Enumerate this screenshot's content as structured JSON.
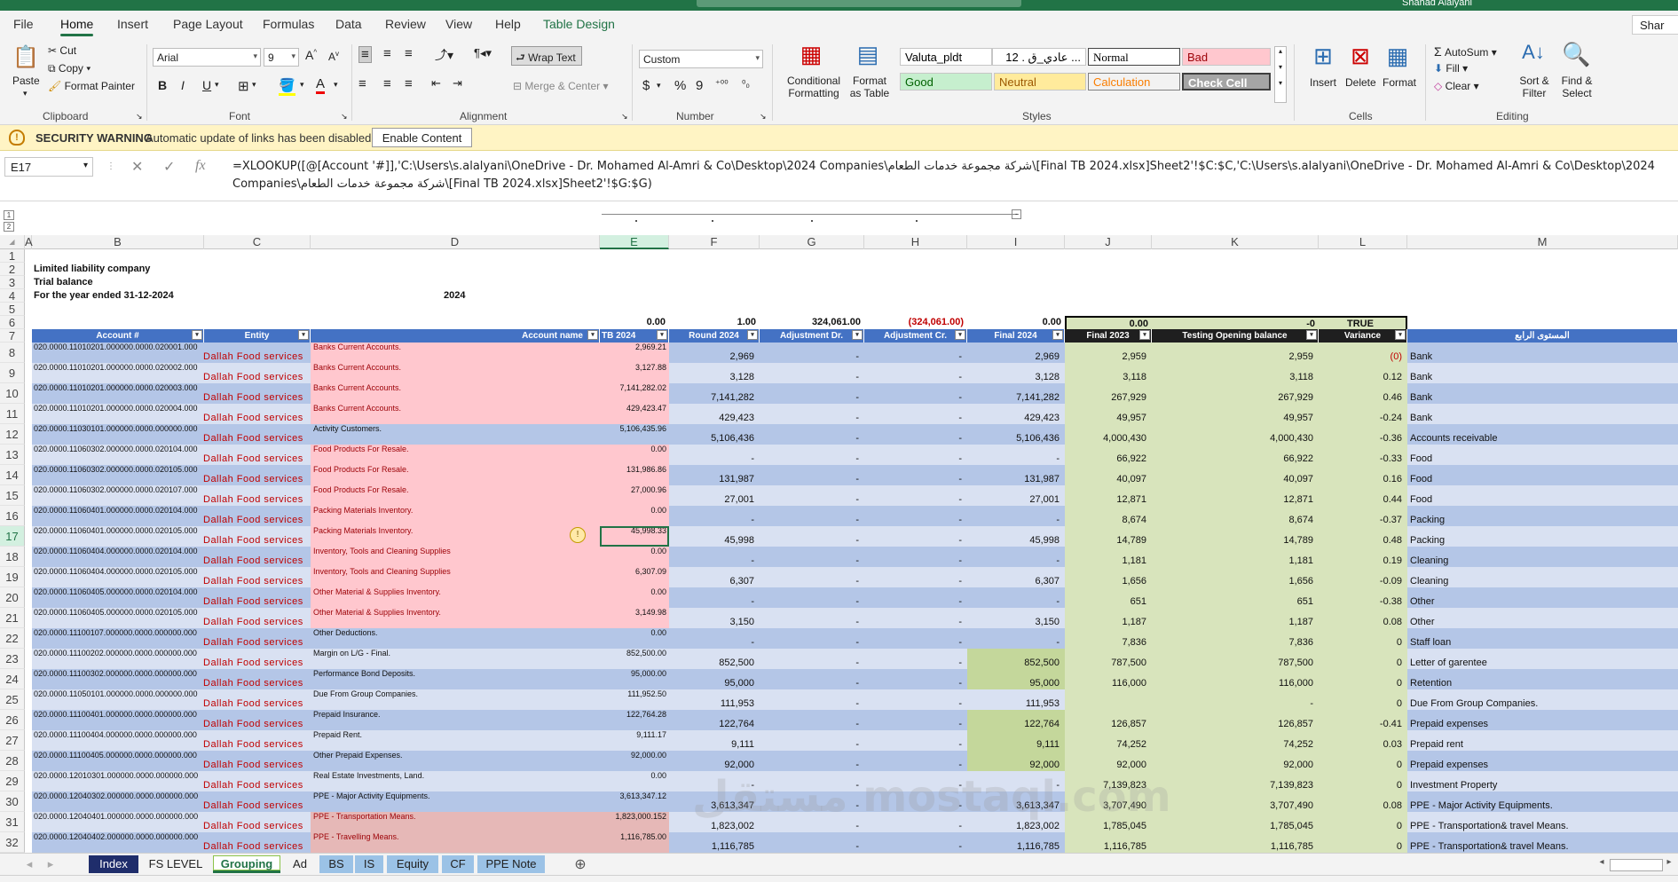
{
  "app": {
    "user": "Shahad Alalyani"
  },
  "menu": {
    "items": [
      "File",
      "Home",
      "Insert",
      "Page Layout",
      "Formulas",
      "Data",
      "Review",
      "View",
      "Help",
      "Table Design"
    ],
    "share": "Shar"
  },
  "ribbon": {
    "clipboard": {
      "paste": "Paste",
      "cut": "Cut",
      "copy": "Copy",
      "format_painter": "Format Painter",
      "label": "Clipboard"
    },
    "font": {
      "name": "Arial",
      "size": "9",
      "label": "Font",
      "bold": "B",
      "italic": "I",
      "underline": "U"
    },
    "alignment": {
      "wrap": "Wrap Text",
      "merge": "Merge & Center",
      "label": "Alignment"
    },
    "number": {
      "format": "Custom",
      "label": "Number",
      "currency": "$",
      "percent": "%",
      "comma": "9"
    },
    "styles": {
      "cond": "Conditional Formatting",
      "format_table": "Format as Table",
      "label": "Styles",
      "cells": [
        {
          "text": "Valuta_pldt",
          "bg": "#ffffff",
          "fg": "#000000"
        },
        {
          "text": "عادي_ق . 12 ...",
          "bg": "#ffffff",
          "fg": "#000000"
        },
        {
          "text": "Normal",
          "bg": "#ffffff",
          "fg": "#000000"
        },
        {
          "text": "Bad",
          "bg": "#ffc7ce",
          "fg": "#9c0006"
        },
        {
          "text": "Good",
          "bg": "#c6efce",
          "fg": "#006100"
        },
        {
          "text": "Neutral",
          "bg": "#ffeb9c",
          "fg": "#9c5700"
        },
        {
          "text": "Calculation",
          "bg": "#f2f2f2",
          "fg": "#fa7d00"
        },
        {
          "text": "Check Cell",
          "bg": "#a5a5a5",
          "fg": "#ffffff"
        }
      ]
    },
    "cells": {
      "insert": "Insert",
      "delete": "Delete",
      "format": "Format",
      "label": "Cells"
    },
    "editing": {
      "autosum": "AutoSum",
      "fill": "Fill",
      "clear": "Clear",
      "sort": "Sort & Filter",
      "find": "Find & Select",
      "label": "Editing"
    }
  },
  "security": {
    "title": "SECURITY WARNING",
    "message": "Automatic update of links has been disabled",
    "button": "Enable Content"
  },
  "formula_bar": {
    "name_box": "E17",
    "formula": "=XLOOKUP([@[Account '#]],'C:\\Users\\s.alalyani\\OneDrive - Dr. Mohamed Al-Amri & Co\\Desktop\\2024 Companies\\شركة مجموعة خدمات الطعام\\[Final TB 2024.xlsx]Sheet2'!$C:$C,'C:\\Users\\s.alalyani\\OneDrive - Dr. Mohamed Al-Amri & Co\\Desktop\\2024 Companies\\شركة مجموعة خدمات الطعام\\[Final TB 2024.xlsx]Sheet2'!$G:$G)"
  },
  "columns": [
    "A",
    "B",
    "C",
    "D",
    "E",
    "F",
    "G",
    "H",
    "I",
    "J",
    "K",
    "L",
    "M"
  ],
  "sheet": {
    "company": "Limited liability company",
    "title": "Trial balance",
    "period": "For the year ended 31-12-2024",
    "year": "2024",
    "row6": {
      "E": "0.00",
      "F": "1.00",
      "G": "324,061.00",
      "H": "(324,061.00)",
      "I": "0.00",
      "J": "0.00",
      "K": "-0",
      "L": "TRUE"
    },
    "headers": [
      "Account #",
      "Entity",
      "Account name",
      "TB 2024",
      "Round 2024",
      "Adjustment Dr.",
      "Adjustment Cr.",
      "Final 2024",
      "Final 2023",
      "Testing Opening balance",
      "Variance",
      "المستوى الرابع"
    ],
    "rows": [
      {
        "n": "8",
        "acc": "020.0000.11010201.000000.0000.020001.000",
        "ent": "Dallah Food  services",
        "name": "Banks Current Accounts.",
        "tb": "2,969.21",
        "rnd": "2,969",
        "dr": "-",
        "cr": "-",
        "f24": "2,969",
        "f23": "2,959",
        "test": "2,959",
        "var": "(0)",
        "lvl": "Bank"
      },
      {
        "n": "9",
        "acc": "020.0000.11010201.000000.0000.020002.000",
        "ent": "Dallah Food  services",
        "name": "Banks Current Accounts.",
        "tb": "3,127.88",
        "rnd": "3,128",
        "dr": "-",
        "cr": "-",
        "f24": "3,128",
        "f23": "3,118",
        "test": "3,118",
        "var": "0.12",
        "lvl": "Bank"
      },
      {
        "n": "10",
        "acc": "020.0000.11010201.000000.0000.020003.000",
        "ent": "Dallah Food  services",
        "name": "Banks Current Accounts.",
        "tb": "7,141,282.02",
        "rnd": "7,141,282",
        "dr": "-",
        "cr": "-",
        "f24": "7,141,282",
        "f23": "267,929",
        "test": "267,929",
        "var": "0.46",
        "lvl": "Bank"
      },
      {
        "n": "11",
        "acc": "020.0000.11010201.000000.0000.020004.000",
        "ent": "Dallah Food  services",
        "name": "Banks Current Accounts.",
        "tb": "429,423.47",
        "rnd": "429,423",
        "dr": "-",
        "cr": "-",
        "f24": "429,423",
        "f23": "49,957",
        "test": "49,957",
        "var": "-0.24",
        "lvl": "Bank"
      },
      {
        "n": "12",
        "acc": "020.0000.11030101.000000.0000.000000.000",
        "ent": "Dallah Food  services",
        "name": "Activity Customers.",
        "tb": "5,106,435.96",
        "rnd": "5,106,436",
        "dr": "-",
        "cr": "-",
        "f24": "5,106,436",
        "f23": "4,000,430",
        "test": "4,000,430",
        "var": "-0.36",
        "lvl": "Accounts receivable"
      },
      {
        "n": "13",
        "acc": "020.0000.11060302.000000.0000.020104.000",
        "ent": "Dallah Food  services",
        "name": "Food Products For Resale.",
        "tb": "0.00",
        "rnd": "-",
        "dr": "-",
        "cr": "-",
        "f24": "-",
        "f23": "66,922",
        "test": "66,922",
        "var": "-0.33",
        "lvl": "Food"
      },
      {
        "n": "14",
        "acc": "020.0000.11060302.000000.0000.020105.000",
        "ent": "Dallah Food  services",
        "name": "Food Products For Resale.",
        "tb": "131,986.86",
        "rnd": "131,987",
        "dr": "-",
        "cr": "-",
        "f24": "131,987",
        "f23": "40,097",
        "test": "40,097",
        "var": "0.16",
        "lvl": "Food"
      },
      {
        "n": "15",
        "acc": "020.0000.11060302.000000.0000.020107.000",
        "ent": "Dallah Food  services",
        "name": "Food Products For Resale.",
        "tb": "27,000.96",
        "rnd": "27,001",
        "dr": "-",
        "cr": "-",
        "f24": "27,001",
        "f23": "12,871",
        "test": "12,871",
        "var": "0.44",
        "lvl": "Food"
      },
      {
        "n": "16",
        "acc": "020.0000.11060401.000000.0000.020104.000",
        "ent": "Dallah Food  services",
        "name": "Packing Materials Inventory.",
        "tb": "0.00",
        "rnd": "-",
        "dr": "-",
        "cr": "-",
        "f24": "-",
        "f23": "8,674",
        "test": "8,674",
        "var": "-0.37",
        "lvl": "Packing"
      },
      {
        "n": "17",
        "acc": "020.0000.11060401.000000.0000.020105.000",
        "ent": "Dallah Food  services",
        "name": "Packing Materials Inventory.",
        "tb": "45,998.33",
        "rnd": "45,998",
        "dr": "-",
        "cr": "-",
        "f24": "45,998",
        "f23": "14,789",
        "test": "14,789",
        "var": "0.48",
        "lvl": "Packing"
      },
      {
        "n": "18",
        "acc": "020.0000.11060404.000000.0000.020104.000",
        "ent": "Dallah Food  services",
        "name": "Inventory, Tools and Cleaning Supplies",
        "tb": "0.00",
        "rnd": "-",
        "dr": "-",
        "cr": "-",
        "f24": "-",
        "f23": "1,181",
        "test": "1,181",
        "var": "0.19",
        "lvl": "Cleaning"
      },
      {
        "n": "19",
        "acc": "020.0000.11060404.000000.0000.020105.000",
        "ent": "Dallah Food  services",
        "name": "Inventory, Tools and Cleaning Supplies",
        "tb": "6,307.09",
        "rnd": "6,307",
        "dr": "-",
        "cr": "-",
        "f24": "6,307",
        "f23": "1,656",
        "test": "1,656",
        "var": "-0.09",
        "lvl": "Cleaning"
      },
      {
        "n": "20",
        "acc": "020.0000.11060405.000000.0000.020104.000",
        "ent": "Dallah Food  services",
        "name": "Other Material & Supplies Inventory.",
        "tb": "0.00",
        "rnd": "-",
        "dr": "-",
        "cr": "-",
        "f24": "-",
        "f23": "651",
        "test": "651",
        "var": "-0.38",
        "lvl": "Other"
      },
      {
        "n": "21",
        "acc": "020.0000.11060405.000000.0000.020105.000",
        "ent": "Dallah Food  services",
        "name": "Other Material & Supplies Inventory.",
        "tb": "3,149.98",
        "rnd": "3,150",
        "dr": "-",
        "cr": "-",
        "f24": "3,150",
        "f23": "1,187",
        "test": "1,187",
        "var": "0.08",
        "lvl": "Other"
      },
      {
        "n": "22",
        "acc": "020.0000.11100107.000000.0000.000000.000",
        "ent": "Dallah Food  services",
        "name": "Other Deductions.",
        "tb": "0.00",
        "rnd": "-",
        "dr": "-",
        "cr": "-",
        "f24": "-",
        "f23": "7,836",
        "test": "7,836",
        "var": "0",
        "lvl": "Staff loan"
      },
      {
        "n": "23",
        "acc": "020.0000.11100202.000000.0000.000000.000",
        "ent": "Dallah Food  services",
        "name": "Margin on L/G - Final.",
        "tb": "852,500.00",
        "rnd": "852,500",
        "dr": "-",
        "cr": "-",
        "f24": "852,500",
        "f23": "787,500",
        "test": "787,500",
        "var": "0",
        "lvl": "Letter of garentee"
      },
      {
        "n": "24",
        "acc": "020.0000.11100302.000000.0000.000000.000",
        "ent": "Dallah Food  services",
        "name": "Performance Bond Deposits.",
        "tb": "95,000.00",
        "rnd": "95,000",
        "dr": "-",
        "cr": "-",
        "f24": "95,000",
        "f23": "116,000",
        "test": "116,000",
        "var": "0",
        "lvl": "Retention"
      },
      {
        "n": "25",
        "acc": "020.0000.11050101.000000.0000.000000.000",
        "ent": "Dallah Food  services",
        "name": "Due From Group Companies.",
        "tb": "111,952.50",
        "rnd": "111,953",
        "dr": "-",
        "cr": "-",
        "f24": "111,953",
        "f23": "",
        "test": "-",
        "var": "0",
        "lvl": "Due From Group Companies."
      },
      {
        "n": "26",
        "acc": "020.0000.11100401.000000.0000.000000.000",
        "ent": "Dallah Food  services",
        "name": "Prepaid Insurance.",
        "tb": "122,764.28",
        "rnd": "122,764",
        "dr": "-",
        "cr": "-",
        "f24": "122,764",
        "f23": "126,857",
        "test": "126,857",
        "var": "-0.41",
        "lvl": "Prepaid expenses"
      },
      {
        "n": "27",
        "acc": "020.0000.11100404.000000.0000.000000.000",
        "ent": "Dallah Food  services",
        "name": "Prepaid Rent.",
        "tb": "9,111.17",
        "rnd": "9,111",
        "dr": "-",
        "cr": "-",
        "f24": "9,111",
        "f23": "74,252",
        "test": "74,252",
        "var": "0.03",
        "lvl": "Prepaid rent"
      },
      {
        "n": "28",
        "acc": "020.0000.11100405.000000.0000.000000.000",
        "ent": "Dallah Food  services",
        "name": "Other Prepaid Expenses.",
        "tb": "92,000.00",
        "rnd": "92,000",
        "dr": "-",
        "cr": "-",
        "f24": "92,000",
        "f23": "92,000",
        "test": "92,000",
        "var": "0",
        "lvl": "Prepaid expenses"
      },
      {
        "n": "29",
        "acc": "020.0000.12010301.000000.0000.000000.000",
        "ent": "Dallah Food  services",
        "name": "Real Estate Investments, Land.",
        "tb": "0.00",
        "rnd": "-",
        "dr": "-",
        "cr": "-",
        "f24": "-",
        "f23": "7,139,823",
        "test": "7,139,823",
        "var": "0",
        "lvl": "Investment Property"
      },
      {
        "n": "30",
        "acc": "020.0000.12040302.000000.0000.000000.000",
        "ent": "Dallah Food  services",
        "name": "PPE - Major Activity Equipments.",
        "tb": "3,613,347.12",
        "rnd": "3,613,347",
        "dr": "-",
        "cr": "-",
        "f24": "3,613,347",
        "f23": "3,707,490",
        "test": "3,707,490",
        "var": "0.08",
        "lvl": "PPE - Major Activity Equipments."
      },
      {
        "n": "31",
        "acc": "020.0000.12040401.000000.0000.000000.000",
        "ent": "Dallah Food  services",
        "name": "PPE - Transportation Means.",
        "tb": "1,823,000.152",
        "rnd": "1,823,002",
        "dr": "-",
        "cr": "-",
        "f24": "1,823,002",
        "f23": "1,785,045",
        "test": "1,785,045",
        "var": "0",
        "lvl": "PPE - Transportation& travel Means."
      },
      {
        "n": "32",
        "acc": "020.0000.12040402.000000.0000.000000.000",
        "ent": "Dallah Food  services",
        "name": "PPE - Travelling Means.",
        "tb": "1,116,785.00",
        "rnd": "1,116,785",
        "dr": "-",
        "cr": "-",
        "f24": "1,116,785",
        "f23": "1,116,785",
        "test": "1,116,785",
        "var": "0",
        "lvl": "PPE - Transportation& travel Means."
      }
    ]
  },
  "sheet_tabs": [
    "Index",
    "FS LEVEL",
    "Grouping",
    "Ad",
    "BS",
    "IS",
    "Equity",
    "CF",
    "PPE Note"
  ],
  "watermark": "مستقل mostaql.com"
}
